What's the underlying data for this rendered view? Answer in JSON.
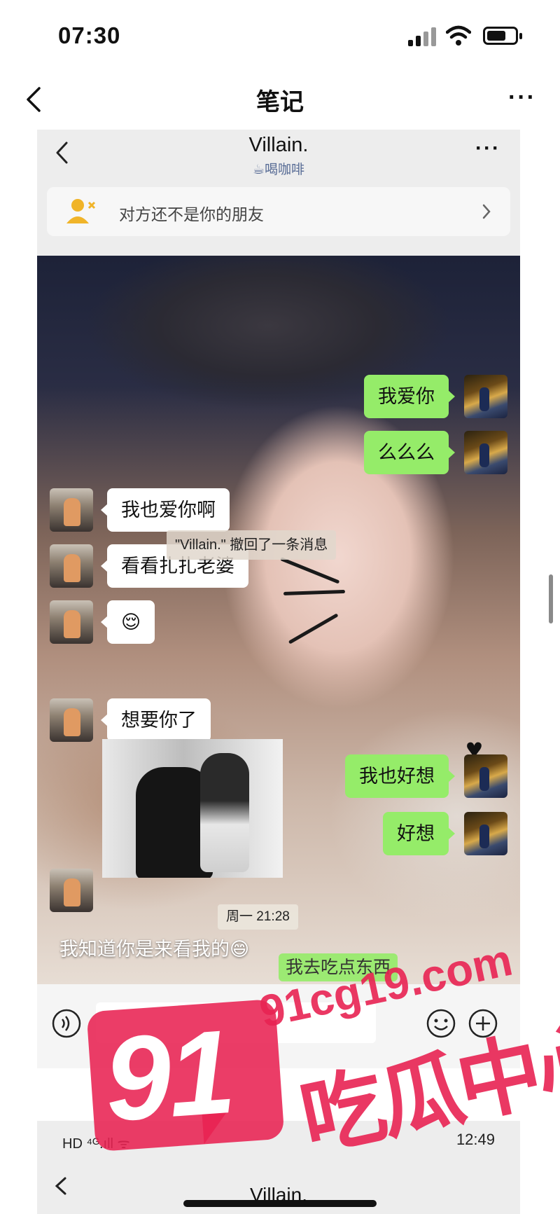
{
  "status_bar": {
    "time": "07:30",
    "battery_icon": "battery-icon",
    "wifi_icon": "wifi-icon",
    "signal_icon": "cellular-signal-icon"
  },
  "nav": {
    "title": "笔记",
    "more": "···",
    "back_icon": "chevron-left-icon"
  },
  "chat": {
    "contact_name": "Villain.",
    "contact_status": "☕喝咖啡",
    "more": "···",
    "notice_text": "对方还不是你的朋友",
    "messages": [
      {
        "side": "me",
        "text": "我爱你"
      },
      {
        "side": "me",
        "text": "么么么"
      },
      {
        "side": "peer",
        "text": "我也爱你啊"
      },
      {
        "side": "peer",
        "text": "看看扎扎老婆"
      },
      {
        "side": "peer",
        "text": "😌"
      },
      {
        "side": "peer",
        "text": "想要你了"
      },
      {
        "side": "me",
        "text": "我也好想"
      },
      {
        "side": "me",
        "text": "好想"
      }
    ],
    "recall_notice": "\"Villain.\" 撤回了一条消息",
    "timestamp": "周一 21:28",
    "caption_left": "我知道你是来看我的😄",
    "caption_right": "我去吃点东西"
  },
  "second_screenshot": {
    "status_left": "HD ⁴ᴳ.ıll ᯤ",
    "status_right_time": "12:49",
    "contact_name": "Villain."
  },
  "watermark": {
    "number": "91",
    "text": "吃瓜中心",
    "url": "91cg19.com"
  },
  "colors": {
    "bubble_me": "#95ec69",
    "bubble_peer": "#ffffff",
    "link_blue": "#576b95",
    "watermark_pink": "#e82252"
  }
}
